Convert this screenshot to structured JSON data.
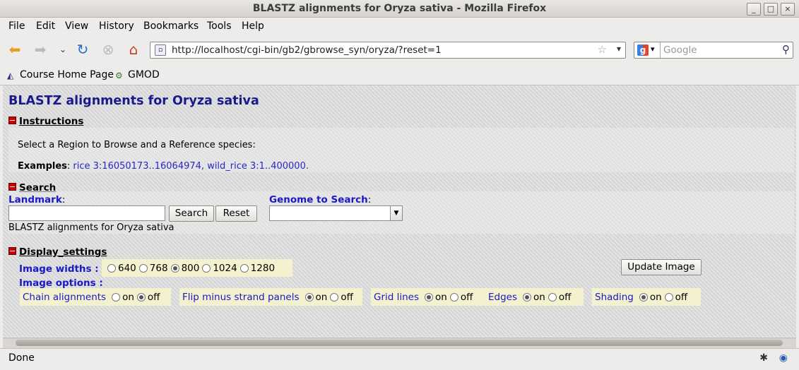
{
  "window": {
    "title": "BLASTZ alignments for Oryza sativa - Mozilla Firefox"
  },
  "menu": [
    "File",
    "Edit",
    "View",
    "History",
    "Bookmarks",
    "Tools",
    "Help"
  ],
  "nav": {
    "url": "http://localhost/cgi-bin/gb2/gbrowse_syn/oryza/?reset=1",
    "search_placeholder": "Google"
  },
  "bookmarks": [
    "Course Home Page",
    "GMOD"
  ],
  "page": {
    "title": "BLASTZ alignments for Oryza sativa",
    "instructions": {
      "heading": "Instructions",
      "line1": "Select a Region to Browse and a Reference species:",
      "examples_label": "Examples",
      "examples_colon": ": ",
      "example1": "rice 3:16050173..16064974",
      "example_sep": ", ",
      "example2": "wild_rice 3:1..400000",
      "examples_end": "."
    },
    "search": {
      "heading": "Search",
      "landmark_label": "Landmark",
      "genome_label": "Genome to Search",
      "search_button": "Search",
      "reset_button": "Reset",
      "description": "BLASTZ alignments for Oryza sativa"
    },
    "display": {
      "heading": "Display_settings",
      "image_widths_label": "Image widths",
      "widths": [
        "640",
        "768",
        "800",
        "1024",
        "1280"
      ],
      "selected_width": "800",
      "update_button": "Update Image",
      "image_options_label": "Image options",
      "on": "on",
      "off": "off",
      "options": [
        {
          "label": "Chain alignments",
          "value": "off"
        },
        {
          "label": "Flip minus strand panels",
          "value": "on"
        },
        {
          "label": "Grid lines",
          "value": "on"
        },
        {
          "label": "Edges",
          "value": "on"
        },
        {
          "label": "Shading",
          "value": "on"
        }
      ]
    }
  },
  "status": {
    "text": "Done"
  }
}
